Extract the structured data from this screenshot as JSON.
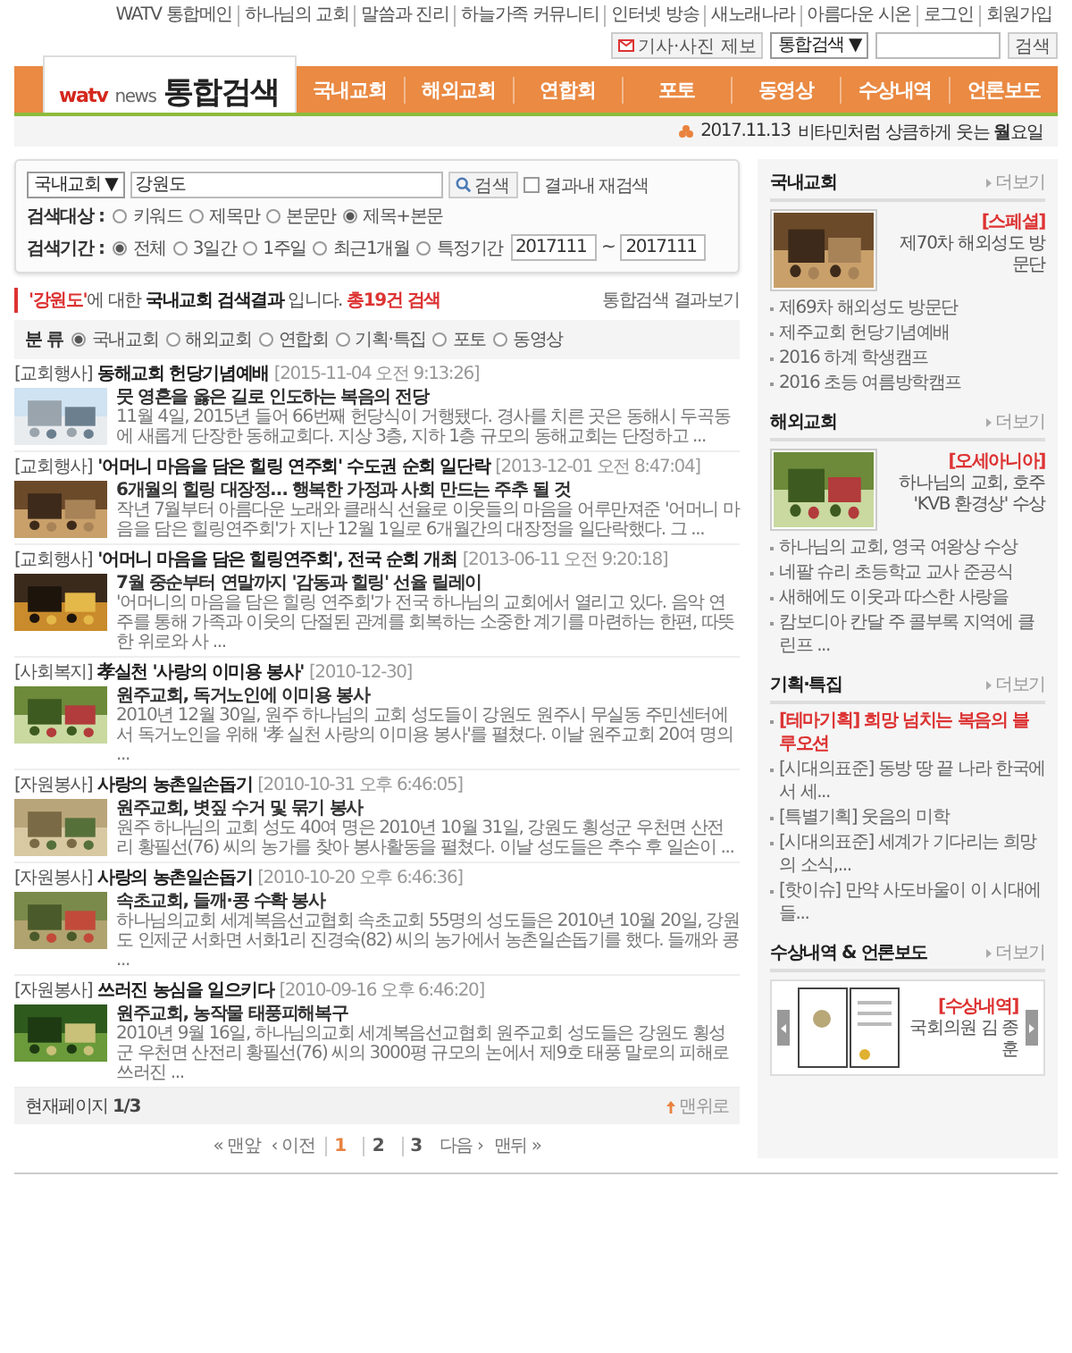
{
  "top_links": [
    "WATV 통합메인",
    "하나님의 교회",
    "말씀과 진리",
    "하늘가족 커뮤니티",
    "인터넷 방송",
    "새노래나라",
    "아름다운 시온",
    "로그인",
    "회원가입"
  ],
  "report_button": "기사·사진 제보",
  "header_search": {
    "scope": "통합검색 ▼",
    "button": "검색"
  },
  "logo": {
    "brand": "watv",
    "sub": "news",
    "title": "통합검색"
  },
  "nav": [
    "국내교회",
    "해외교회",
    "연합회",
    "포토",
    "동영상",
    "수상내역",
    "언론보도"
  ],
  "date_line": {
    "date": "2017.11.13",
    "greeting": "비타민처럼 상큼하게 웃는 **월**요일"
  },
  "search_form": {
    "scope": "국내교회 ▼",
    "query": "강원도",
    "button": "검색",
    "refine": {
      "label": "결과내 재검색",
      "checked": false
    },
    "target": {
      "label": "검색대상 :",
      "options": [
        {
          "label": "키워드",
          "selected": false
        },
        {
          "label": "제목만",
          "selected": false
        },
        {
          "label": "본문만",
          "selected": false
        },
        {
          "label": "제목+본문",
          "selected": true
        }
      ]
    },
    "period": {
      "label": "검색기간 :",
      "options": [
        {
          "label": "전체",
          "selected": true
        },
        {
          "label": "3일간",
          "selected": false
        },
        {
          "label": "1주일",
          "selected": false
        },
        {
          "label": "최근1개월",
          "selected": false
        },
        {
          "label": "특정기간",
          "selected": false
        }
      ],
      "from": "2017111",
      "separator": "~",
      "to": "2017111"
    }
  },
  "summary": {
    "parts": [
      {
        "kind": "query",
        "text": "'강원도'"
      },
      {
        "kind": "plain",
        "text": "에 대한 "
      },
      {
        "kind": "bold",
        "text": "국내교회 검색결과"
      },
      {
        "kind": "plain",
        "text": " 입니다. "
      },
      {
        "kind": "count",
        "text": "총19건 검색"
      }
    ],
    "link": "통합검색 결과보기"
  },
  "category_filter": {
    "label": "분 류",
    "options": [
      {
        "label": "국내교회",
        "selected": true
      },
      {
        "label": "해외교회",
        "selected": false
      },
      {
        "label": "연합회",
        "selected": false
      },
      {
        "label": "기획·특집",
        "selected": false
      },
      {
        "label": "포토",
        "selected": false
      },
      {
        "label": "동영상",
        "selected": false
      }
    ]
  },
  "results": [
    {
      "category": "[교회행사]",
      "title": "동해교회 헌당기념예배",
      "date": "[2015-11-04 오전 9:13:26]",
      "headline": "뭇 영혼을 옳은 길로 인도하는 복음의 전당",
      "snippet": "11월 4일, 2015년 들어 66번째 헌당식이 거행됐다. 경사를 치른 곳은 동해시 두곡동에 새롭게 단장한 동해교회다. 지상 3층, 지하 1층 규모의 동해교회는 단정하고 ..."
    },
    {
      "category": "[교회행사]",
      "title": "'어머니 마음을 담은 힐링 연주회' 수도권 순회 일단락",
      "date": "[2013-12-01 오전 8:47:04]",
      "headline": "6개월의 힐링 대장정… 행복한 가정과 사회 만드는 주추 될 것",
      "snippet": "작년 7월부터 아름다운 노래와 클래식 선율로 이웃들의 마음을 어루만져준 '어머니 마음을 담은 힐링연주회'가 지난 12월 1일로 6개월간의 대장정을 일단락했다. 그 ..."
    },
    {
      "category": "[교회행사]",
      "title": "'어머니 마음을 담은 힐링연주회', 전국 순회 개최",
      "date": "[2013-06-11 오전 9:20:18]",
      "headline": "7월 중순부터 연말까지 '감동과 힐링' 선율 릴레이",
      "snippet": "'어머니의 마음을 담은 힐링 연주회'가 전국 하나님의 교회에서 열리고 있다. 음악 연주를 통해 가족과 이웃의 단절된 관계를 회복하는 소중한 계기를 마련하는 한편, 따뜻한 위로와 사 ..."
    },
    {
      "category": "[사회복지]",
      "title": "孝실천 '사랑의 이미용 봉사'",
      "date": "[2010-12-30]",
      "headline": "원주교회, 독거노인에 이미용 봉사",
      "snippet": "2010년 12월 30일, 원주 하나님의 교회 성도들이 강원도 원주시 무실동 주민센터에서 독거노인을 위해 '孝 실천 사랑의 이미용 봉사'를 펼쳤다. 이날 원주교회 20여 명의 ..."
    },
    {
      "category": "[자원봉사]",
      "title": "사랑의 농촌일손돕기",
      "date": "[2010-10-31 오후 6:46:05]",
      "headline": "원주교회, 볏짚 수거 및 묶기 봉사",
      "snippet": "원주 하나님의 교회 성도 40여 명은 2010년 10월 31일, 강원도 횡성군 우천면 산전리 황필선(76) 씨의 농가를 찾아 봉사활동을 펼쳤다. 이날 성도들은 추수 후 일손이 ..."
    },
    {
      "category": "[자원봉사]",
      "title": "사랑의 농촌일손돕기",
      "date": "[2010-10-20 오후 6:46:36]",
      "headline": "속초교회, 들깨·콩 수확 봉사",
      "snippet": "하나님의교회 세계복음선교협회 속초교회 55명의 성도들은 2010년 10월 20일, 강원도 인제군 서화면 서화1리 진경숙(82) 씨의 농가에서 농촌일손돕기를 했다. 들깨와 콩 ..."
    },
    {
      "category": "[자원봉사]",
      "title": "쓰러진 농심을 일으키다",
      "date": "[2010-09-16 오후 6:46:20]",
      "headline": "원주교회, 농작물 태풍피해복구",
      "snippet": "2010년 9월 16일, 하나님의교회 세계복음선교협회 원주교회 성도들은 강원도 횡성군 우천면 산전리 황필선(76) 씨의 3000평 규모의 논에서 제9호 태풍 말로의 피해로 쓰러진 ..."
    }
  ],
  "footer": {
    "page": "현재페이지 **1/3**",
    "top": "맨위로"
  },
  "pagination": {
    "first": "« 맨앞",
    "prev": "‹ 이전",
    "pages": [
      {
        "label": "1",
        "selected": true
      },
      {
        "label": "2",
        "selected": false
      },
      {
        "label": "3",
        "selected": false
      }
    ],
    "next": "다음 ›",
    "last": "맨뒤 »"
  },
  "sidebar": [
    {
      "kind": "feature",
      "title": "국내교회",
      "more": "더보기",
      "feature": {
        "tag": "[스페셜]",
        "text": "제70차 해외성도 방문단"
      },
      "items": [
        {
          "text": "제69차 해외성도 방문단",
          "highlight": false
        },
        {
          "text": "제주교회 헌당기념예배",
          "highlight": false
        },
        {
          "text": "2016 하계 학생캠프",
          "highlight": false
        },
        {
          "text": "2016 초등 여름방학캠프",
          "highlight": false
        }
      ]
    },
    {
      "kind": "feature",
      "title": "해외교회",
      "more": "더보기",
      "feature": {
        "tag": "[오세아니아]",
        "text": "하나님의 교회, 호주 'KVB 환경상' 수상"
      },
      "items": [
        {
          "text": "하나님의 교회, 영국 여왕상 수상",
          "highlight": false
        },
        {
          "text": "네팔 슈리 초등학교 교사 준공식",
          "highlight": false
        },
        {
          "text": "새해에도 이웃과 따스한 사랑을",
          "highlight": false
        },
        {
          "text": "캄보디아 칸달 주 콜부록 지역에 클린프 ...",
          "highlight": false
        }
      ]
    },
    {
      "kind": "list",
      "title": "기획·특집",
      "more": "더보기",
      "items": [
        {
          "text": "[테마기획] 희망 넘치는 복음의 블루오션",
          "highlight": true
        },
        {
          "text": "[시대의표준] 동방 땅 끝 나라 한국에서 세...",
          "highlight": false
        },
        {
          "text": "[특별기획] 웃음의 미학",
          "highlight": false
        },
        {
          "text": "[시대의표준] 세계가 기다리는 희망의 소식,...",
          "highlight": false
        },
        {
          "text": "[핫이슈] 만약 사도바울이 이 시대에 들...",
          "highlight": false
        }
      ]
    },
    {
      "kind": "carousel",
      "title": "수상내역 & 언론보도",
      "more": "더보기",
      "feature": {
        "tag": "[수상내역]",
        "text": "국회의원 김 종 훈"
      }
    }
  ]
}
